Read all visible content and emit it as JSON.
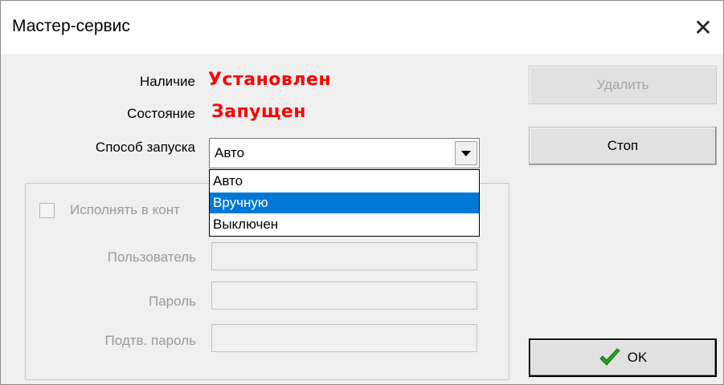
{
  "window": {
    "title": "Мастер-сервис",
    "close_label": "✕"
  },
  "status": {
    "presence_label": "Наличие",
    "presence_value": "Установлен",
    "state_label": "Состояние",
    "state_value": "Запущен",
    "value_color": "#ff0000"
  },
  "startup": {
    "label": "Способ запуска",
    "selected": "Авто",
    "options": [
      "Авто",
      "Вручную",
      "Выключен"
    ],
    "highlighted_option": "Вручную",
    "highlight_color": "#0078d7"
  },
  "account_group": {
    "checkbox_label": "Исполнять в конт",
    "user_label": "Пользователь",
    "user_value": "",
    "password_label": "Пароль",
    "password_value": "",
    "confirm_label": "Подтв. пароль",
    "confirm_value": ""
  },
  "buttons": {
    "delete_label": "Удалить",
    "stop_label": "Стоп",
    "ok_label": "OK",
    "ok_icon": "green-checkmark-icon"
  }
}
